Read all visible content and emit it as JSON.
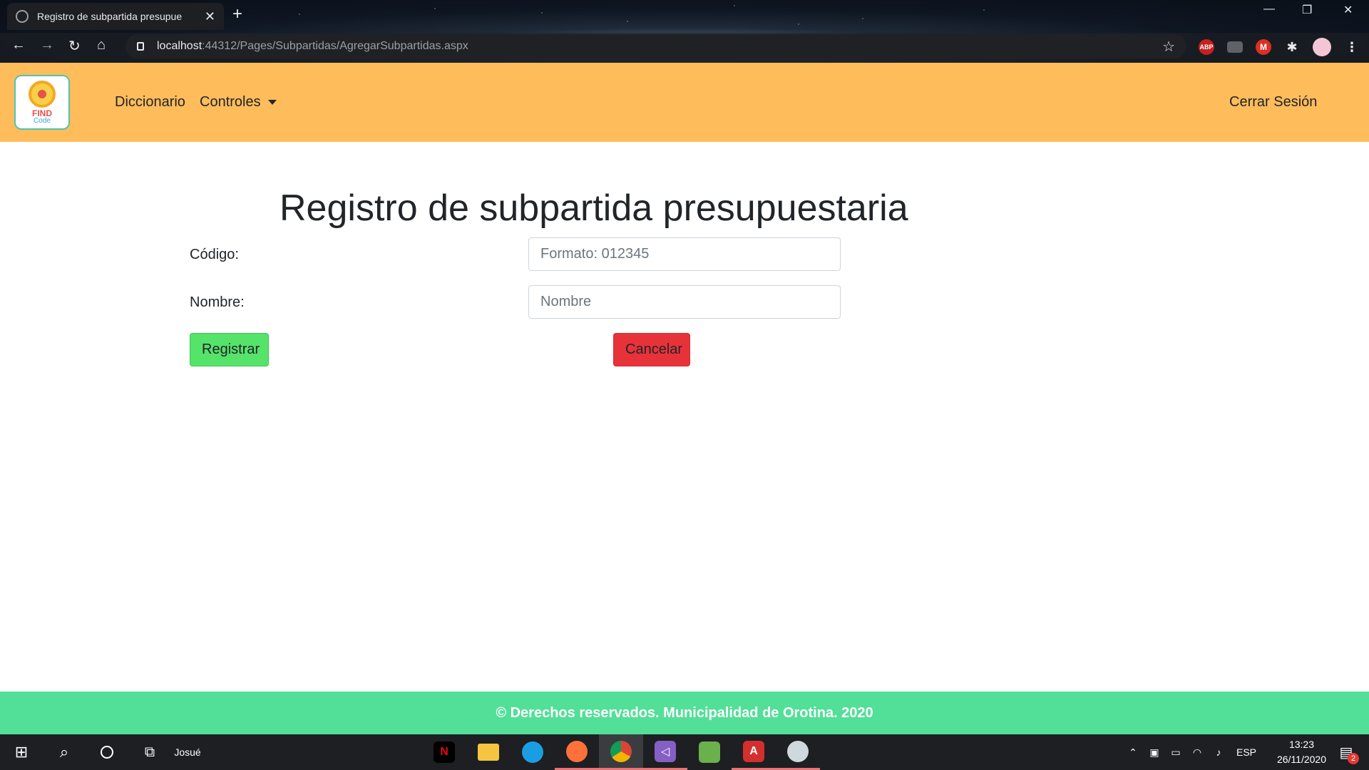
{
  "browser": {
    "tab_title": "Registro de subpartida presupue",
    "url_host": "localhost",
    "url_path": ":44312/Pages/Subpartidas/AgregarSubpartidas.aspx",
    "extensions": [
      "ABP",
      "M"
    ]
  },
  "navbar": {
    "logo_text_top": "FIND",
    "logo_text_bottom": "Code",
    "links": [
      "Diccionario",
      "Controles"
    ],
    "logout": "Cerrar Sesión"
  },
  "form": {
    "title": "Registro de subpartida presupuestaria",
    "codigo_label": "Código:",
    "codigo_placeholder": "Formato: 012345",
    "nombre_label": "Nombre:",
    "nombre_placeholder": "Nombre",
    "register_button": "Registrar",
    "cancel_button": "Cancelar"
  },
  "footer": {
    "text": "© Derechos reservados. Municipalidad de Orotina. 2020"
  },
  "taskbar": {
    "user": "Josué",
    "language": "ESP",
    "time": "13:23",
    "date": "26/11/2020",
    "notifications": "2"
  },
  "colors": {
    "navbar": "#ffbc5b",
    "footer": "#52df97",
    "register": "#55e36a",
    "cancel": "#e8323a"
  }
}
